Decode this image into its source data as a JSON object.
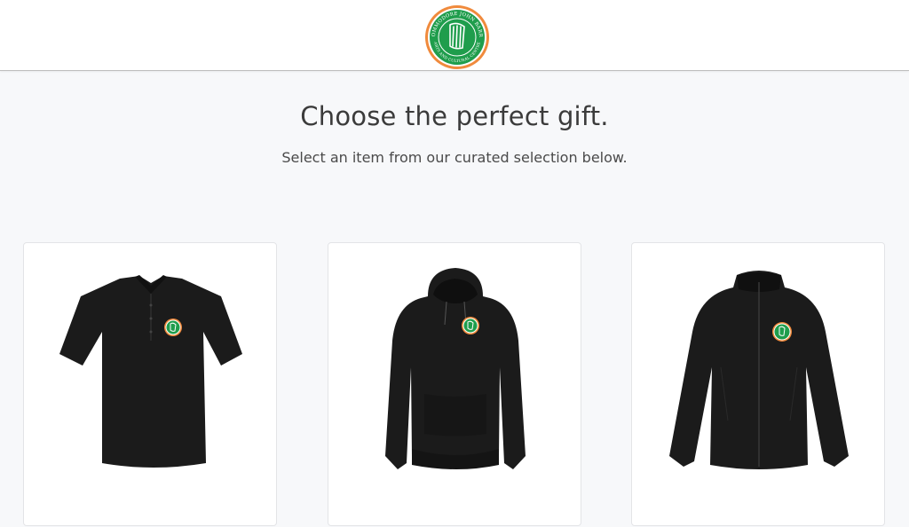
{
  "header": {
    "logo_text_top": "COMMODORE JOHN BARRY",
    "logo_text_bottom": "ARTS AND CULTURAL CENTRE",
    "logo_icon": "harp-icon"
  },
  "hero": {
    "title": "Choose the perfect gift.",
    "subtitle": "Select an item from our curated selection below."
  },
  "products": [
    {
      "type": "polo-shirt",
      "image": "black polo shirt with crest"
    },
    {
      "type": "hoodie",
      "image": "black hoodie with crest"
    },
    {
      "type": "jacket",
      "image": "black full-zip jacket with crest"
    }
  ],
  "colors": {
    "brand_green": "#1f9d4c",
    "brand_orange": "#f08a3c",
    "garment": "#1b1b1b"
  }
}
